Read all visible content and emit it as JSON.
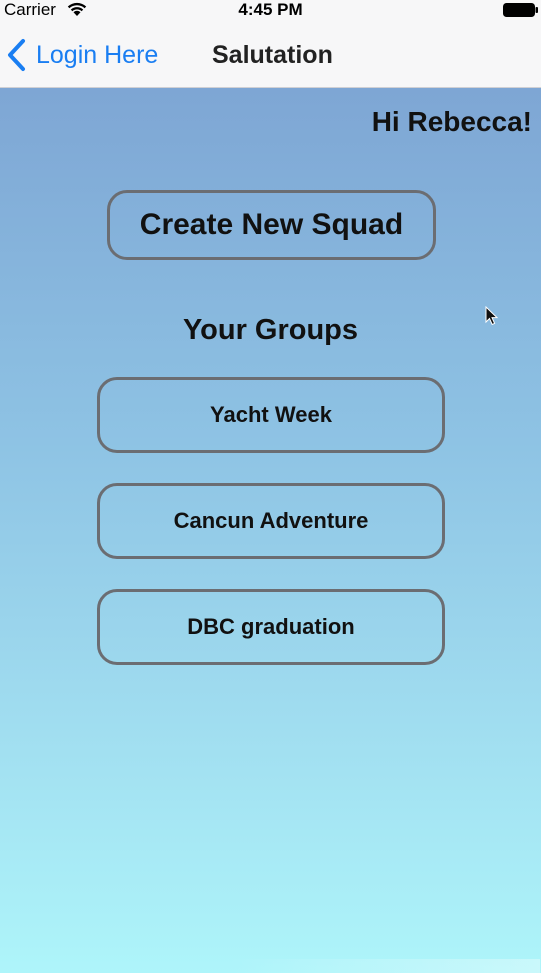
{
  "status_bar": {
    "carrier": "Carrier",
    "time": "4:45 PM",
    "wifi_icon": "wifi-icon",
    "battery_icon": "battery-icon"
  },
  "nav_bar": {
    "back_label": "Login Here",
    "back_icon": "chevron-left-icon",
    "title": "Salutation",
    "accent_color": "#1a7ef2"
  },
  "content": {
    "greeting": "Hi Rebecca!",
    "create_button_label": "Create New Squad",
    "groups_heading": "Your Groups",
    "groups": [
      {
        "label": "Yacht Week"
      },
      {
        "label": "Cancun Adventure"
      },
      {
        "label": "DBC graduation"
      }
    ],
    "background_gradient": [
      "#7ea6d4",
      "#aef5fa"
    ]
  }
}
